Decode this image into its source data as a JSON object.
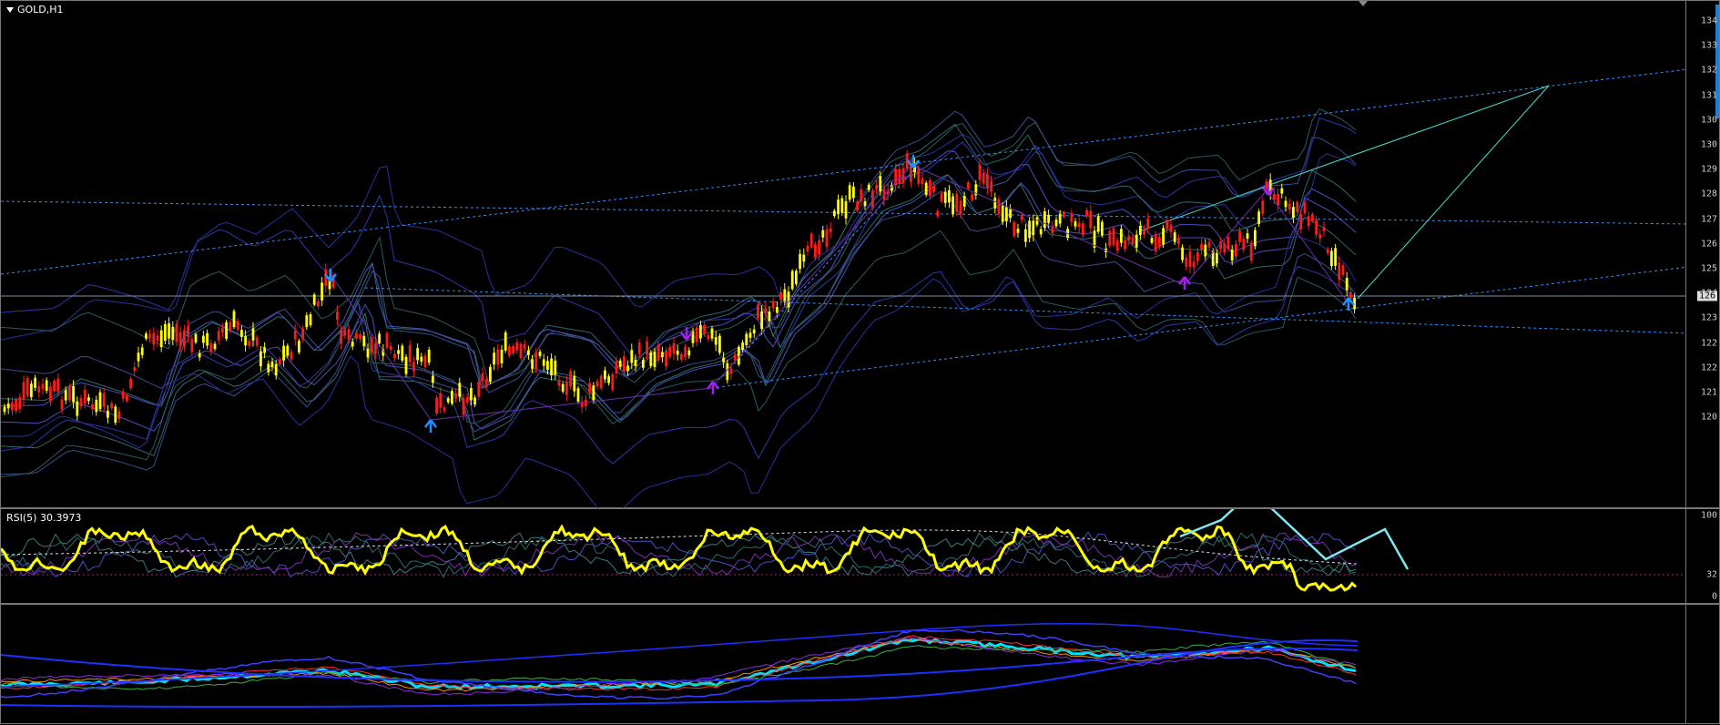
{
  "main": {
    "title": "GOLD,H1",
    "price_ticks": [
      "134",
      "133",
      "132",
      "131",
      "130",
      "130",
      "129",
      "128",
      "127",
      "126",
      "125",
      "124",
      "123",
      "122",
      "122",
      "121",
      "120"
    ],
    "current_price": "126"
  },
  "rsi": {
    "title": "RSI(5) 30.3973",
    "ticks": [
      "100",
      "32",
      "0"
    ]
  },
  "colors": {
    "bull_candle": "#ffff00",
    "bear_candle": "#ff1a1a",
    "trendline": "#2f8fff",
    "cyan_line": "#40e0d0",
    "rsi_line": "#ffff00",
    "rsi_arrow": "#7fe8f0",
    "fractal_blue": "#1e90ff",
    "fractal_purple": "#a020f0"
  }
}
